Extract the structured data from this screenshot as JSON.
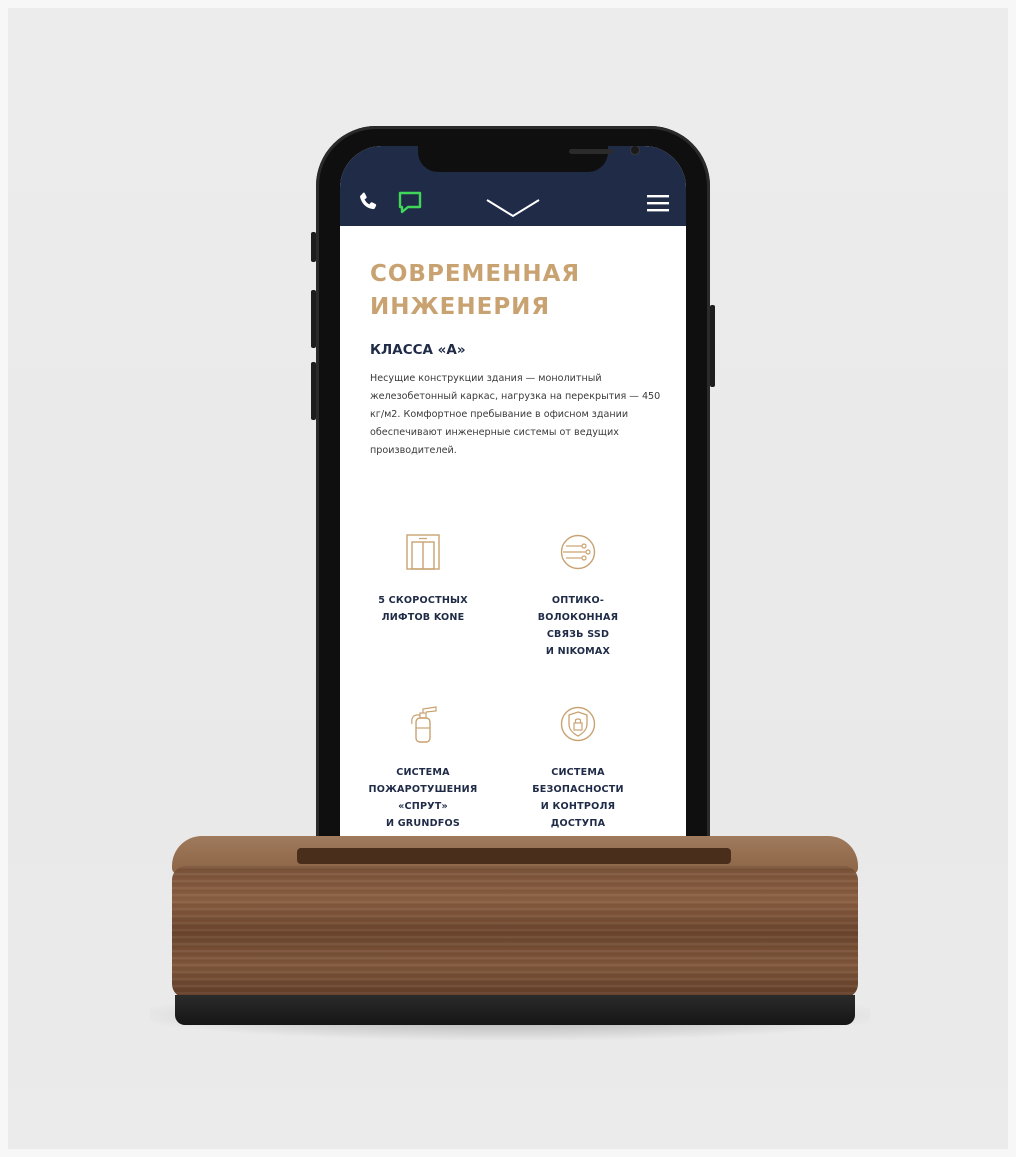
{
  "app": {
    "nav": {
      "phone_icon": "phone-icon",
      "chat_icon": "chat-icon",
      "logo_icon": "chevron-logo-icon",
      "menu_icon": "hamburger-menu-icon"
    },
    "section": {
      "title": "СОВРЕМЕННАЯ\nИНЖЕНЕРИЯ",
      "subtitle": "КЛАССА «А»",
      "body": "Несущие конструкции здания — монолитный железобетонный каркас, нагрузка на перекрытия — 450 кг/м2. Комфортное пребывание в офисном здании обеспечивают инженерные системы от ведущих производителей."
    },
    "features": [
      {
        "icon": "elevator-icon",
        "label": "5 СКОРОСТНЫХ\nЛИФТОВ KONE"
      },
      {
        "icon": "fiber-optic-icon",
        "label": "ОПТИКО-\nВОЛОКОННАЯ\nСВЯЗЬ SSD\nИ NIKOMAX"
      },
      {
        "icon": "fire-extinguisher-icon",
        "label": "СИСТЕМА\nПОЖАРОТУШЕНИЯ\n«СПРУТ»\nИ GRUNDFOS"
      },
      {
        "icon": "security-shield-icon",
        "label": "СИСТЕМА\nБЕЗОПАСНОСТИ\nИ КОНТРОЛЯ\nДОСТУПА\n«РУБЕЖ»"
      }
    ]
  },
  "colors": {
    "navbar": "#1f2b47",
    "accent_gold": "#c9a271",
    "chat_green": "#3fd65a",
    "text_dark": "#1f2b47"
  }
}
